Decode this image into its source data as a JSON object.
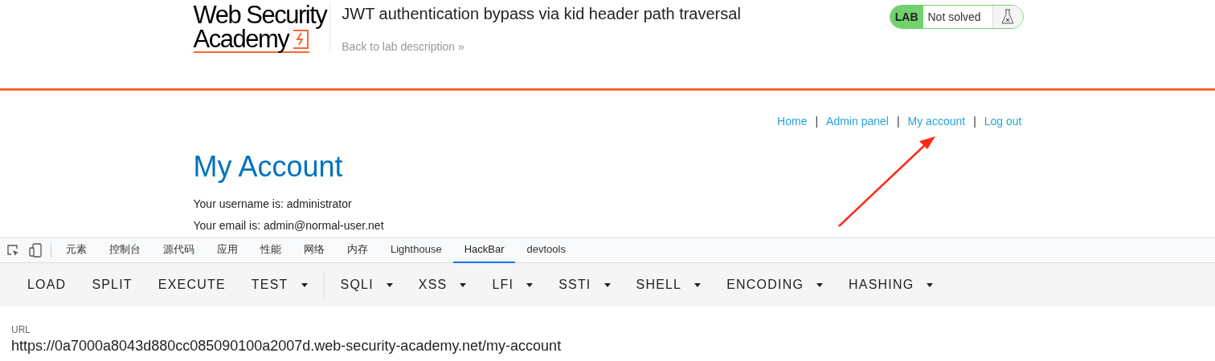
{
  "header": {
    "logo_lines": [
      "Web Security",
      "Academy"
    ],
    "lab_title": "JWT authentication bypass via kid header path traversal",
    "back_link": "Back to lab description",
    "back_arrow": "»",
    "lab_badge": "LAB",
    "lab_status": "Not solved",
    "solved": false
  },
  "nav": [
    {
      "label": "Home"
    },
    {
      "label": "Admin panel"
    },
    {
      "label": "My account"
    },
    {
      "label": "Log out"
    }
  ],
  "nav_separator": "|",
  "page": {
    "heading": "My Account",
    "lines": [
      "Your username is: administrator",
      "Your email is: admin@normal-user.net"
    ]
  },
  "annotation": {
    "kind": "arrow"
  },
  "devtools": {
    "tabs": [
      {
        "label": "元素",
        "selected": false
      },
      {
        "label": "控制台",
        "selected": false
      },
      {
        "label": "源代码",
        "selected": false
      },
      {
        "label": "应用",
        "selected": false
      },
      {
        "label": "性能",
        "selected": false
      },
      {
        "label": "网络",
        "selected": false
      },
      {
        "label": "内存",
        "selected": false
      },
      {
        "label": "Lighthouse",
        "selected": false
      },
      {
        "label": "HackBar",
        "selected": true
      },
      {
        "label": "devtools",
        "selected": false
      }
    ]
  },
  "hackbar": {
    "buttons": [
      {
        "label": "LOAD",
        "kind": "plain"
      },
      {
        "label": "SPLIT",
        "kind": "plain"
      },
      {
        "label": "EXECUTE",
        "kind": "plain"
      },
      {
        "label": "TEST",
        "kind": "dropdown"
      },
      {
        "kind": "divider"
      },
      {
        "label": "SQLI",
        "kind": "dropdown"
      },
      {
        "label": "XSS",
        "kind": "dropdown"
      },
      {
        "label": "LFI",
        "kind": "dropdown"
      },
      {
        "label": "SSTI",
        "kind": "dropdown"
      },
      {
        "label": "SHELL",
        "kind": "dropdown"
      },
      {
        "label": "ENCODING",
        "kind": "dropdown"
      },
      {
        "label": "HASHING",
        "kind": "dropdown"
      }
    ],
    "url_label": "URL",
    "url_value": "https://0a7000a8043d880cc085090100a2007d.web-security-academy.net/my-account"
  }
}
